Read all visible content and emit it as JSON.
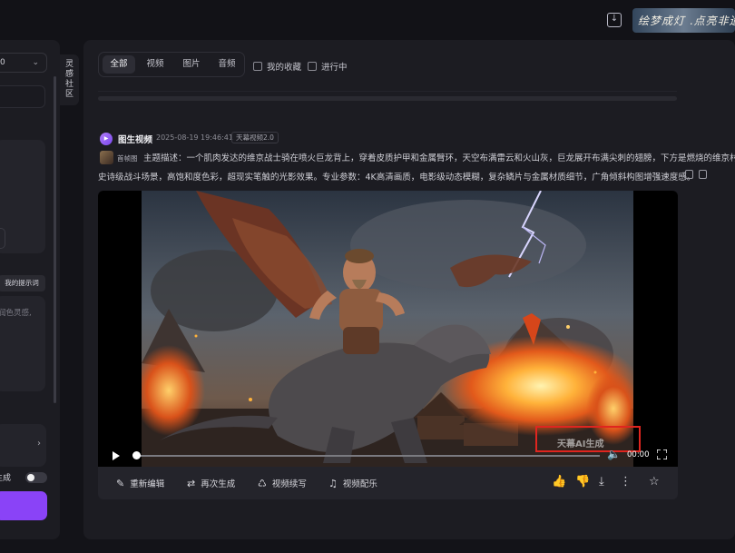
{
  "topbar": {
    "download_icon": "download-icon",
    "banner_text": "绘梦成灯 .点亮非遗"
  },
  "left_panel": {
    "select_value": "0",
    "prompt_chip": "我的提示词",
    "textarea_fragment": "润色灵感,",
    "generate_label": "生成",
    "toggle_on": false,
    "accent_color": "#8a43f7"
  },
  "side_tab": {
    "label": "灵感社区"
  },
  "filters": {
    "tabs": [
      {
        "label": "全部",
        "active": true
      },
      {
        "label": "视频",
        "active": false
      },
      {
        "label": "图片",
        "active": false
      },
      {
        "label": "音频",
        "active": false
      }
    ],
    "favorites": "我的收藏",
    "in_progress": "进行中"
  },
  "record": {
    "type_label": "图生视频",
    "timestamp": "2025-08-19 19:46:41",
    "model": "天幕视频2.0",
    "ref_label": "首帧图",
    "prompt_line1": "主题描述：一个肌肉发达的维京战士骑在喷火巨龙背上，穿着皮质护甲和金属臂环，天空布满雷云和火山灰，巨龙展开布满尖刺的翅膀，下方是燃烧的维京村落",
    "prompt_line2": "史诗级战斗场景，高饱和度色彩，超现实笔触的光影效果。专业参数：4K高清画质，电影级动态模糊，复杂鳞片与金属材质细节，广角倾斜构图增强速度感。"
  },
  "video": {
    "time": "00:00",
    "watermark": "天幕AI生成",
    "progress": 0
  },
  "actions": [
    {
      "label": "重新编辑",
      "icon": "edit-icon"
    },
    {
      "label": "再次生成",
      "icon": "regenerate-icon"
    },
    {
      "label": "视频续写",
      "icon": "continue-icon"
    },
    {
      "label": "视频配乐",
      "icon": "music-icon"
    }
  ],
  "right_actions": [
    "thumbs-up-icon",
    "thumbs-down-icon",
    "download-icon",
    "more-icon",
    "star-icon"
  ]
}
